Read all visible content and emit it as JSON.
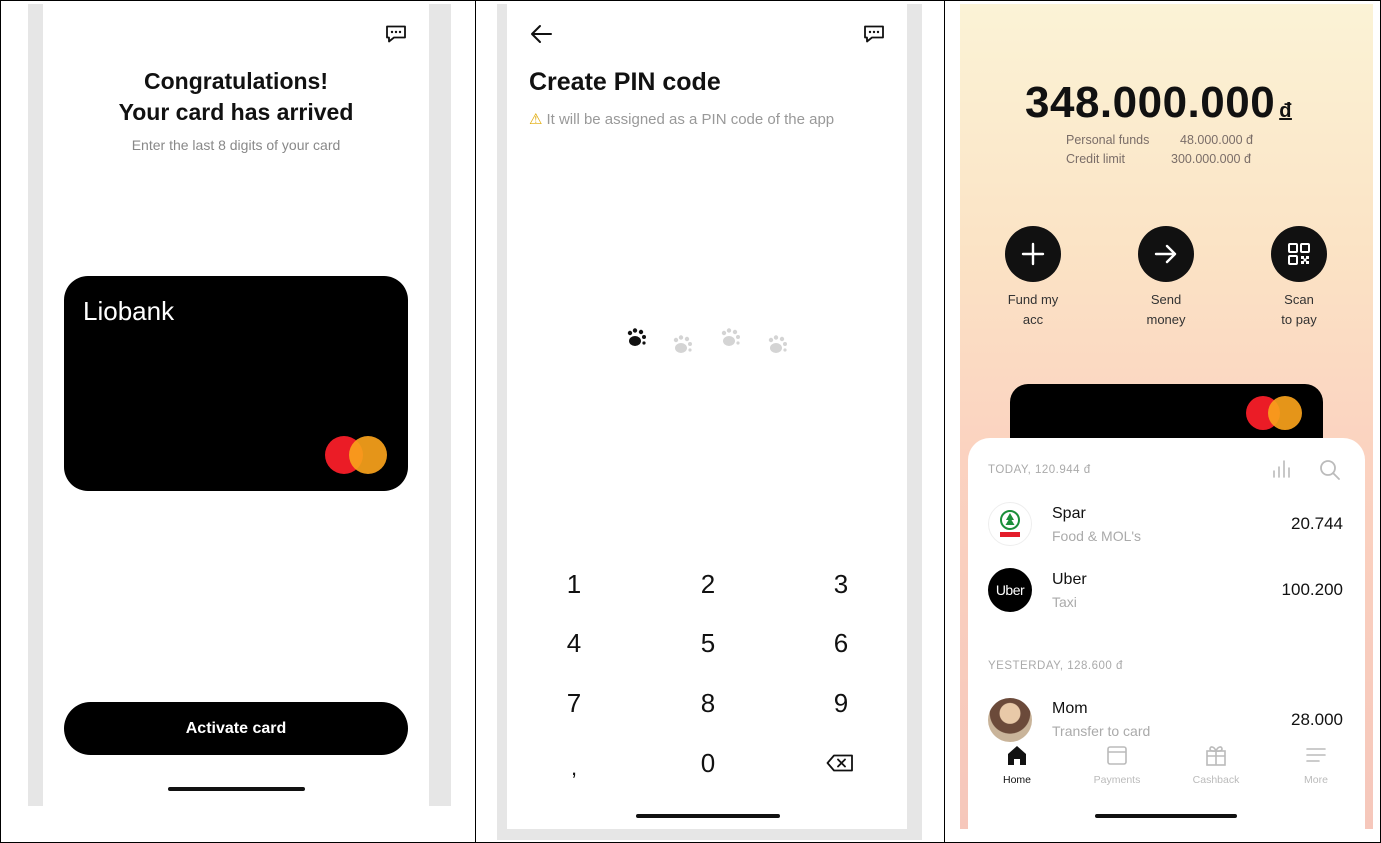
{
  "screen_activate": {
    "chat_icon": "chat-icon",
    "title_line1": "Congratulations!",
    "title_line2": "Your card has arrived",
    "subtitle": "Enter the last 8 digits of your card",
    "card_brand": "Liobank",
    "card_network_icon": "mastercard-logo",
    "activate_button": "Activate card"
  },
  "screen_pin": {
    "back_icon": "arrow-left-icon",
    "chat_icon": "chat-icon",
    "title": "Create PIN code",
    "warning_icon": "warning-icon",
    "note": "It will be assigned as a PIN code of the app",
    "pin_indicators": {
      "filled": 1,
      "total": 4,
      "icon": "paw-icon"
    },
    "keypad": [
      "1",
      "2",
      "3",
      "4",
      "5",
      "6",
      "7",
      "8",
      "9",
      ",",
      "0"
    ],
    "backspace_icon": "backspace-icon"
  },
  "screen_home": {
    "balance": "348.000.000",
    "currency": "đ",
    "funds": [
      {
        "label": "Personal funds",
        "value": "48.000.000 đ"
      },
      {
        "label": "Credit limit",
        "value": "300.000.000 đ"
      }
    ],
    "actions": [
      {
        "icon": "plus-icon",
        "line1": "Fund my",
        "line2": "acc"
      },
      {
        "icon": "arrow-right-icon",
        "line1": "Send",
        "line2": "money"
      },
      {
        "icon": "qr-code-icon",
        "line1": "Scan",
        "line2": "to pay"
      }
    ],
    "sections": [
      {
        "header": "TODAY, 120.944 đ",
        "transactions": [
          {
            "name": "Spar",
            "category": "Food & MOL's",
            "amount": "20.744",
            "logo": "spar-logo"
          },
          {
            "name": "Uber",
            "category": "Taxi",
            "amount": "100.200",
            "logo": "uber-logo",
            "logo_text": "Uber"
          }
        ]
      },
      {
        "header": "YESTERDAY, 128.600 đ",
        "transactions": [
          {
            "name": "Mom",
            "category": "Transfer to card",
            "amount": "28.000",
            "logo": "avatar"
          }
        ]
      }
    ],
    "nav": [
      {
        "label": "Home",
        "icon": "home-icon",
        "active": true
      },
      {
        "label": "Payments",
        "icon": "wallet-icon",
        "active": false
      },
      {
        "label": "Cashback",
        "icon": "gift-icon",
        "active": false
      },
      {
        "label": "More",
        "icon": "menu-icon",
        "active": false
      }
    ],
    "colors": {
      "mastercard_red": "#eb1c26",
      "mastercard_orange": "#f8a21b"
    }
  }
}
